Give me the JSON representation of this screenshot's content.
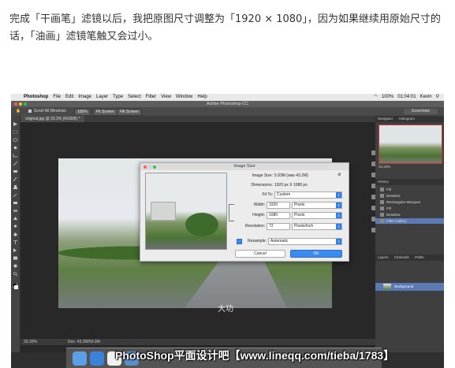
{
  "article": {
    "text": "完成「干画笔」滤镜以后，我把原图尺寸调整为「1920 × 1080」，因为如果继续用原始尺寸的话，「油画」滤镜笔触又会过小。"
  },
  "menubar": {
    "app": "Photoshop",
    "items": [
      "File",
      "Edit",
      "Image",
      "Layer",
      "Type",
      "Select",
      "Filter",
      "View",
      "Window",
      "Help"
    ],
    "battery": "100%",
    "time": "01:04:01",
    "user": "Kevin"
  },
  "window": {
    "title": "Adobe Photoshop CC"
  },
  "options_bar": {
    "scroll_all": "Scroll All Windows",
    "zoom_100": "100%",
    "fit_screen": "Fit Screen",
    "fill_screen": "Fill Screen",
    "workspace": "Essentials"
  },
  "document_tab": "original.jpg @ 33.3% (RGB/8) *",
  "dialog": {
    "title": "Image Size",
    "image_size_label": "Image Size:",
    "image_size_value": "5.93M (was 43.2M)",
    "dimensions_label": "Dimensions:",
    "dimensions_value": "1920 px  X  1080 px",
    "fit_to_label": "Fit To:",
    "fit_to_value": "Custom",
    "width_label": "Width:",
    "width_value": "1920",
    "width_unit": "Pixels",
    "height_label": "Height:",
    "height_value": "1080",
    "height_unit": "Pixels",
    "resolution_label": "Resolution:",
    "resolution_value": "72",
    "resolution_unit": "Pixels/Inch",
    "resample_label": "Resample:",
    "resample_value": "Automatic",
    "cancel": "Cancel",
    "ok": "OK"
  },
  "panels": {
    "navigator_tab": "Navigator",
    "histogram_tab": "Histogram",
    "zoom": "33.33%",
    "history_tab": "History",
    "history_items": [
      "Fill",
      "Deselect",
      "Rectangular Marquee",
      "Fill",
      "Deselect",
      "Filter Gallery"
    ],
    "layers_tab": "Layers",
    "channels_tab": "Channels",
    "paths_tab": "Paths",
    "layer_name": "Background"
  },
  "status_bar": {
    "zoom": "33.33%",
    "doc": "Doc: 43.2M/59.9M"
  },
  "watermark": "PhotoShop平面设计吧【www.lineqq.com/tieba/1783】",
  "photo_overlay": "大功"
}
